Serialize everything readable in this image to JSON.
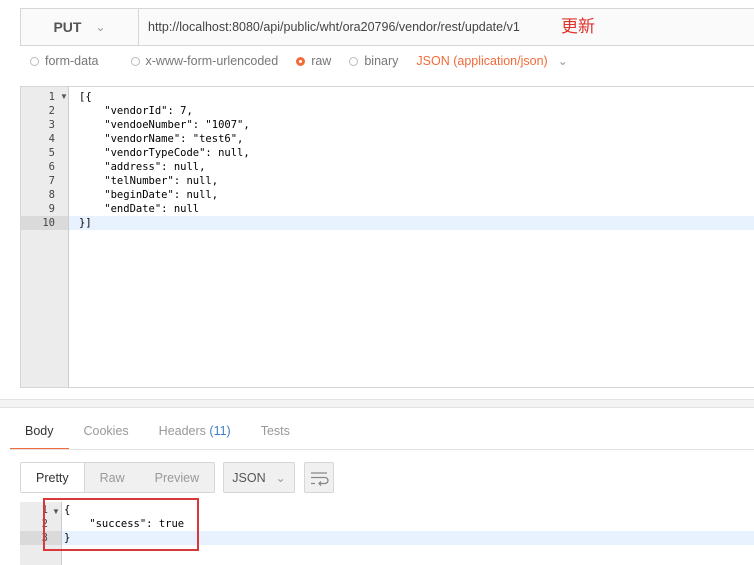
{
  "request": {
    "method": "PUT",
    "url": "http://localhost:8080/api/public/wht/ora20796/vendor/rest/update/v1",
    "annotation": "更新"
  },
  "body_types": {
    "form_data": "form-data",
    "urlencoded": "x-www-form-urlencoded",
    "raw": "raw",
    "binary": "binary",
    "content_type": "JSON (application/json)"
  },
  "editor": {
    "line_numbers": [
      "1",
      "2",
      "3",
      "4",
      "5",
      "6",
      "7",
      "8",
      "9",
      "10"
    ],
    "lines": [
      "[{",
      "    \"vendorId\": 7,",
      "    \"vendoeNumber\": \"1007\",",
      "    \"vendorName\": \"test6\",",
      "    \"vendorTypeCode\": null,",
      "    \"address\": null,",
      "    \"telNumber\": null,",
      "    \"beginDate\": null,",
      "    \"endDate\": null",
      "}]"
    ]
  },
  "response_tabs": {
    "body": "Body",
    "cookies": "Cookies",
    "headers": "Headers",
    "headers_count": "(11)",
    "tests": "Tests"
  },
  "view_modes": {
    "pretty": "Pretty",
    "raw": "Raw",
    "preview": "Preview",
    "format": "JSON"
  },
  "response": {
    "line_numbers": [
      "1",
      "2",
      "3"
    ],
    "lines": [
      "{",
      "    \"success\": true",
      "}"
    ]
  },
  "colors": {
    "accent": "#f26b3a",
    "annotation_red": "#d9383a",
    "headers_count": "#3f7fc6"
  }
}
